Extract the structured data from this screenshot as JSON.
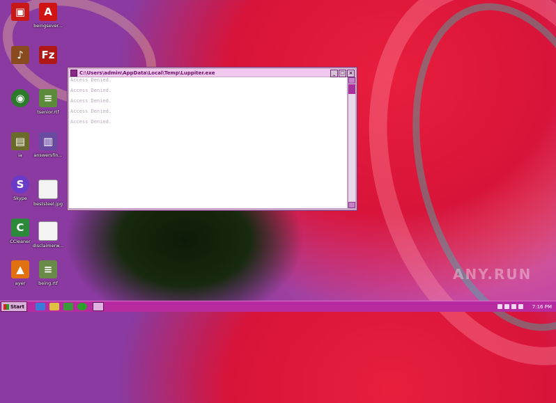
{
  "desktop": {
    "icons": [
      {
        "label": "",
        "icon": "red-app-icon",
        "color": "#c81818"
      },
      {
        "label": "",
        "icon": "acrobat-pdf-icon",
        "color": "#d01414"
      },
      {
        "label": "",
        "icon": "music-app-icon",
        "color": "#8a4a20"
      },
      {
        "label": "",
        "icon": "filezilla-icon",
        "color": "#b01818"
      },
      {
        "label": "",
        "icon": "chrome-icon",
        "color": "#2a7a2a"
      },
      {
        "label": "",
        "icon": "rtf-document-icon",
        "color": "#5a8a3a"
      },
      {
        "label": "",
        "icon": "folder-icon",
        "color": "#6a6a2a"
      },
      {
        "label": "answersfin...",
        "icon": "document-icon",
        "color": "#6a4aa0"
      },
      {
        "label": "Skype",
        "icon": "skype-icon",
        "color": "#6a3ac8"
      },
      {
        "label": "beststeel.jpg",
        "icon": "image-file-icon",
        "color": "#f4f4f4"
      },
      {
        "label": "CCleaner",
        "icon": "ccleaner-icon",
        "color": "#2a8a3a"
      },
      {
        "label": "disclaimerw...",
        "icon": "image-file-icon",
        "color": "#f4f4f4"
      },
      {
        "label": "",
        "icon": "vlc-media-icon",
        "color": "#e07010"
      },
      {
        "label": "",
        "icon": "rtf-document-icon",
        "color": "#6a8a4a"
      }
    ],
    "visible_partial_labels": [
      "tsenior.rtf",
      "beingsever...",
      "ayer",
      "ia",
      "being.rtf"
    ]
  },
  "window": {
    "title": "C:\\Users\\admin\\AppData\\Local\\Temp\\Luppiter.exe",
    "min": "_",
    "max": "□",
    "close": "×",
    "lines": [
      "Access Denied.",
      "Access Denied.",
      "Access Denied.",
      "Access Denied.",
      "Access Denied."
    ]
  },
  "taskbar": {
    "start_label": "Start",
    "clock": "7:16 PM"
  },
  "watermark": "ANY.RUN"
}
